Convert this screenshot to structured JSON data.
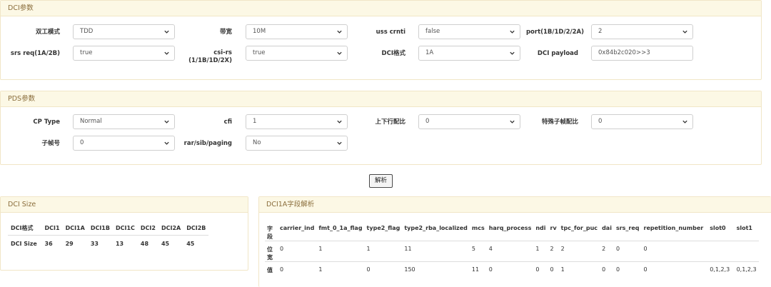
{
  "dci_panel": {
    "title": "DCI参数",
    "fields": {
      "duplex": {
        "label": "双工模式",
        "value": "TDD"
      },
      "bandwidth": {
        "label": "带宽",
        "value": "10M"
      },
      "uss_crnti": {
        "label": "uss crnti",
        "value": "false"
      },
      "port": {
        "label": "port(1B/1D/2/2A)",
        "value": "2"
      },
      "srs_req": {
        "label": "srs req(1A/2B)",
        "value": "true"
      },
      "csi_rs": {
        "label_line1": "csi-rs",
        "label_line2": "(1/1B/1D/2X)",
        "value": "true"
      },
      "dci_format": {
        "label": "DCI格式",
        "value": "1A"
      },
      "dci_payload": {
        "label": "DCI payload",
        "value": "0x84b2c020>>3"
      }
    }
  },
  "pds_panel": {
    "title": "PDS参数",
    "fields": {
      "cp_type": {
        "label": "CP Type",
        "value": "Normal"
      },
      "cfi": {
        "label": "cfi",
        "value": "1"
      },
      "ul_dl_config": {
        "label": "上下行配比",
        "value": "0"
      },
      "special_subframe": {
        "label": "特殊子帧配比",
        "value": "0"
      },
      "subframe_no": {
        "label": "子帧号",
        "value": "0"
      },
      "rar_sib_paging": {
        "label": "rar/sib/paging",
        "value": "No"
      }
    }
  },
  "parse_button": {
    "label": "解析"
  },
  "dci_size_panel": {
    "title": "DCI Size",
    "headers": [
      "DCI格式",
      "DCI1",
      "DCI1A",
      "DCI1B",
      "DCI1C",
      "DCI2",
      "DCI2A",
      "DCI2B"
    ],
    "row": [
      "DCI Size",
      "36",
      "29",
      "33",
      "13",
      "48",
      "45",
      "45"
    ]
  },
  "field_panel": {
    "title": "DCI1A字段解析",
    "headers": [
      "字段",
      "carrier_ind",
      "fmt_0_1a_flag",
      "type2_flag",
      "type2_rba_localized",
      "mcs",
      "harq_process",
      "ndi",
      "rv",
      "tpc_for_puc",
      "dai",
      "srs_req",
      "repetition_number",
      "slot0",
      "slot1"
    ],
    "width_row": [
      "位宽",
      "0",
      "1",
      "1",
      "11",
      "5",
      "4",
      "1",
      "2",
      "2",
      "2",
      "0",
      "0",
      "",
      ""
    ],
    "value_row": [
      "值",
      "0",
      "1",
      "0",
      "150",
      "11",
      "0",
      "0",
      "0",
      "1",
      "0",
      "0",
      "0",
      "0,1,2,3",
      "0,1,2,3"
    ]
  },
  "icons": {
    "select_arrow": "chevron-down-icon"
  },
  "colors": {
    "panel_header_bg": "#fcf8e5",
    "panel_header_text": "#8a6d3b",
    "panel_border": "#f1e6c7"
  }
}
